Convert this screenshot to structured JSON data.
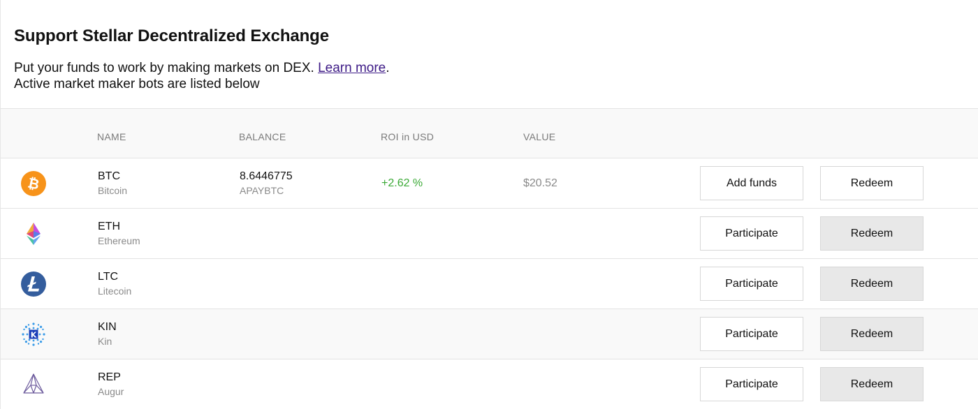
{
  "header": {
    "title": "Support Stellar Decentralized Exchange",
    "line1_text": "Put your funds to work by making markets on DEX. ",
    "learn_more": "Learn more",
    "line1_end": ".",
    "line2": "Active market maker bots are listed below"
  },
  "columns": {
    "name": "NAME",
    "balance": "BALANCE",
    "roi": "ROI in USD",
    "value": "VALUE"
  },
  "rows": [
    {
      "symbol": "BTC",
      "name": "Bitcoin",
      "balance": "8.6446775",
      "balance_unit": "APAYBTC",
      "roi": "+2.62 %",
      "value": "$20.52",
      "primary_label": "Add funds",
      "secondary_label": "Redeem",
      "icon": "bitcoin-icon"
    },
    {
      "symbol": "ETH",
      "name": "Ethereum",
      "primary_label": "Participate",
      "secondary_label": "Redeem",
      "icon": "ethereum-icon"
    },
    {
      "symbol": "LTC",
      "name": "Litecoin",
      "primary_label": "Participate",
      "secondary_label": "Redeem",
      "icon": "litecoin-icon"
    },
    {
      "symbol": "KIN",
      "name": "Kin",
      "primary_label": "Participate",
      "secondary_label": "Redeem",
      "icon": "kin-icon"
    },
    {
      "symbol": "REP",
      "name": "Augur",
      "primary_label": "Participate",
      "secondary_label": "Redeem",
      "icon": "augur-icon"
    }
  ],
  "colors": {
    "roi_positive": "#3aa935",
    "bitcoin": "#f7931a",
    "litecoin": "#345d9d",
    "link": "#3d1a86"
  }
}
